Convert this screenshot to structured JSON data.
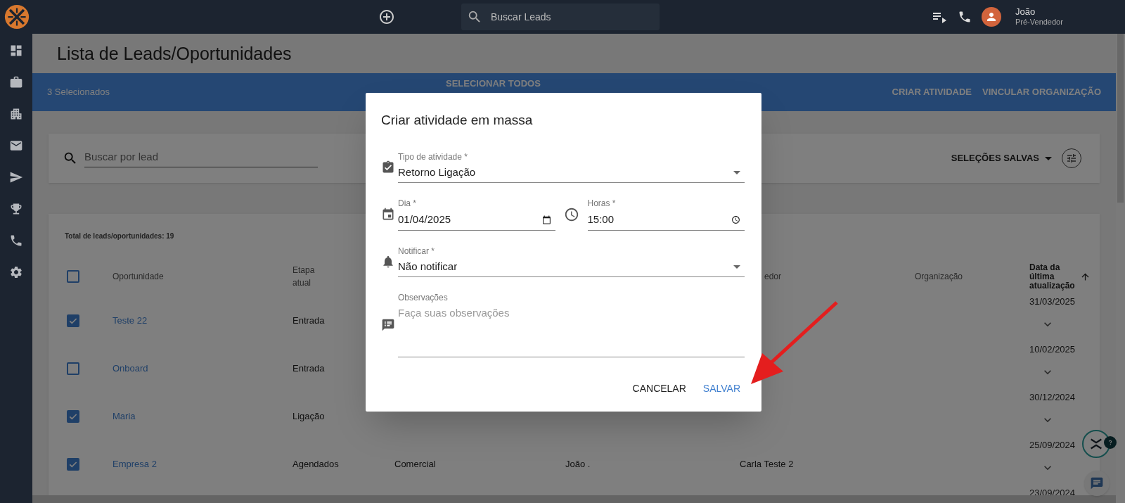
{
  "app_bar": {
    "search_placeholder": "Buscar Leads",
    "user_name": "João",
    "user_role": "Pré-Vendedor"
  },
  "page_title": "Lista de Leads/Oportunidades",
  "selection_bar": {
    "count": "3 Selecionados",
    "select_all": "SELECIONAR TODOS",
    "actions": [
      "CRIAR ATIVIDADE",
      "VINCULAR ORGANIZAÇÃO"
    ]
  },
  "filters": {
    "search_placeholder": "Buscar por lead",
    "saved_selections": "SELEÇÕES SALVAS"
  },
  "table": {
    "total": "Total de leads/oportunidades: 19",
    "header_checked": false,
    "columns": {
      "opportunity": "Oportunidade",
      "stage": "Etapa atual",
      "column_5": "edor",
      "organization": "Organização",
      "updated": "Data da última atualização"
    },
    "rows": [
      {
        "checked": true,
        "opportunity": "Teste 22",
        "stage": "Entrada",
        "updated": "31/03/2025"
      },
      {
        "checked": false,
        "opportunity": "Onboard",
        "stage": "Entrada",
        "updated": "10/02/2025"
      },
      {
        "checked": true,
        "opportunity": "Maria",
        "stage": "Ligação",
        "updated": "30/12/2024"
      },
      {
        "checked": true,
        "opportunity": "Empresa 2",
        "stage": "Agendados",
        "column_3": "Comercial",
        "column_4": "João .",
        "column_5": "Carla Teste 2",
        "updated": "25/09/2024"
      },
      {
        "updated": "23/09/2024"
      }
    ]
  },
  "dialog": {
    "title": "Criar atividade em massa",
    "rows": [
      {
        "fields": [
          {
            "kind": "select",
            "label": "Tipo de atividade *",
            "value": "Retorno Ligação"
          }
        ]
      },
      {
        "fields": [
          {
            "kind": "date",
            "label": "Dia *",
            "value": "01/04/2025"
          },
          {
            "kind": "time",
            "label": "Horas *",
            "value": "15:00"
          }
        ]
      },
      {
        "fields": [
          {
            "kind": "select",
            "label": "Notificar *",
            "value": "Não notificar"
          }
        ]
      },
      {
        "fields": [
          {
            "kind": "textarea",
            "label": "Observações",
            "placeholder": "Faça suas observações"
          }
        ]
      }
    ],
    "buttons": [
      {
        "label": "CANCELAR",
        "primary": false
      },
      {
        "label": "SALVAR",
        "primary": true
      }
    ]
  }
}
